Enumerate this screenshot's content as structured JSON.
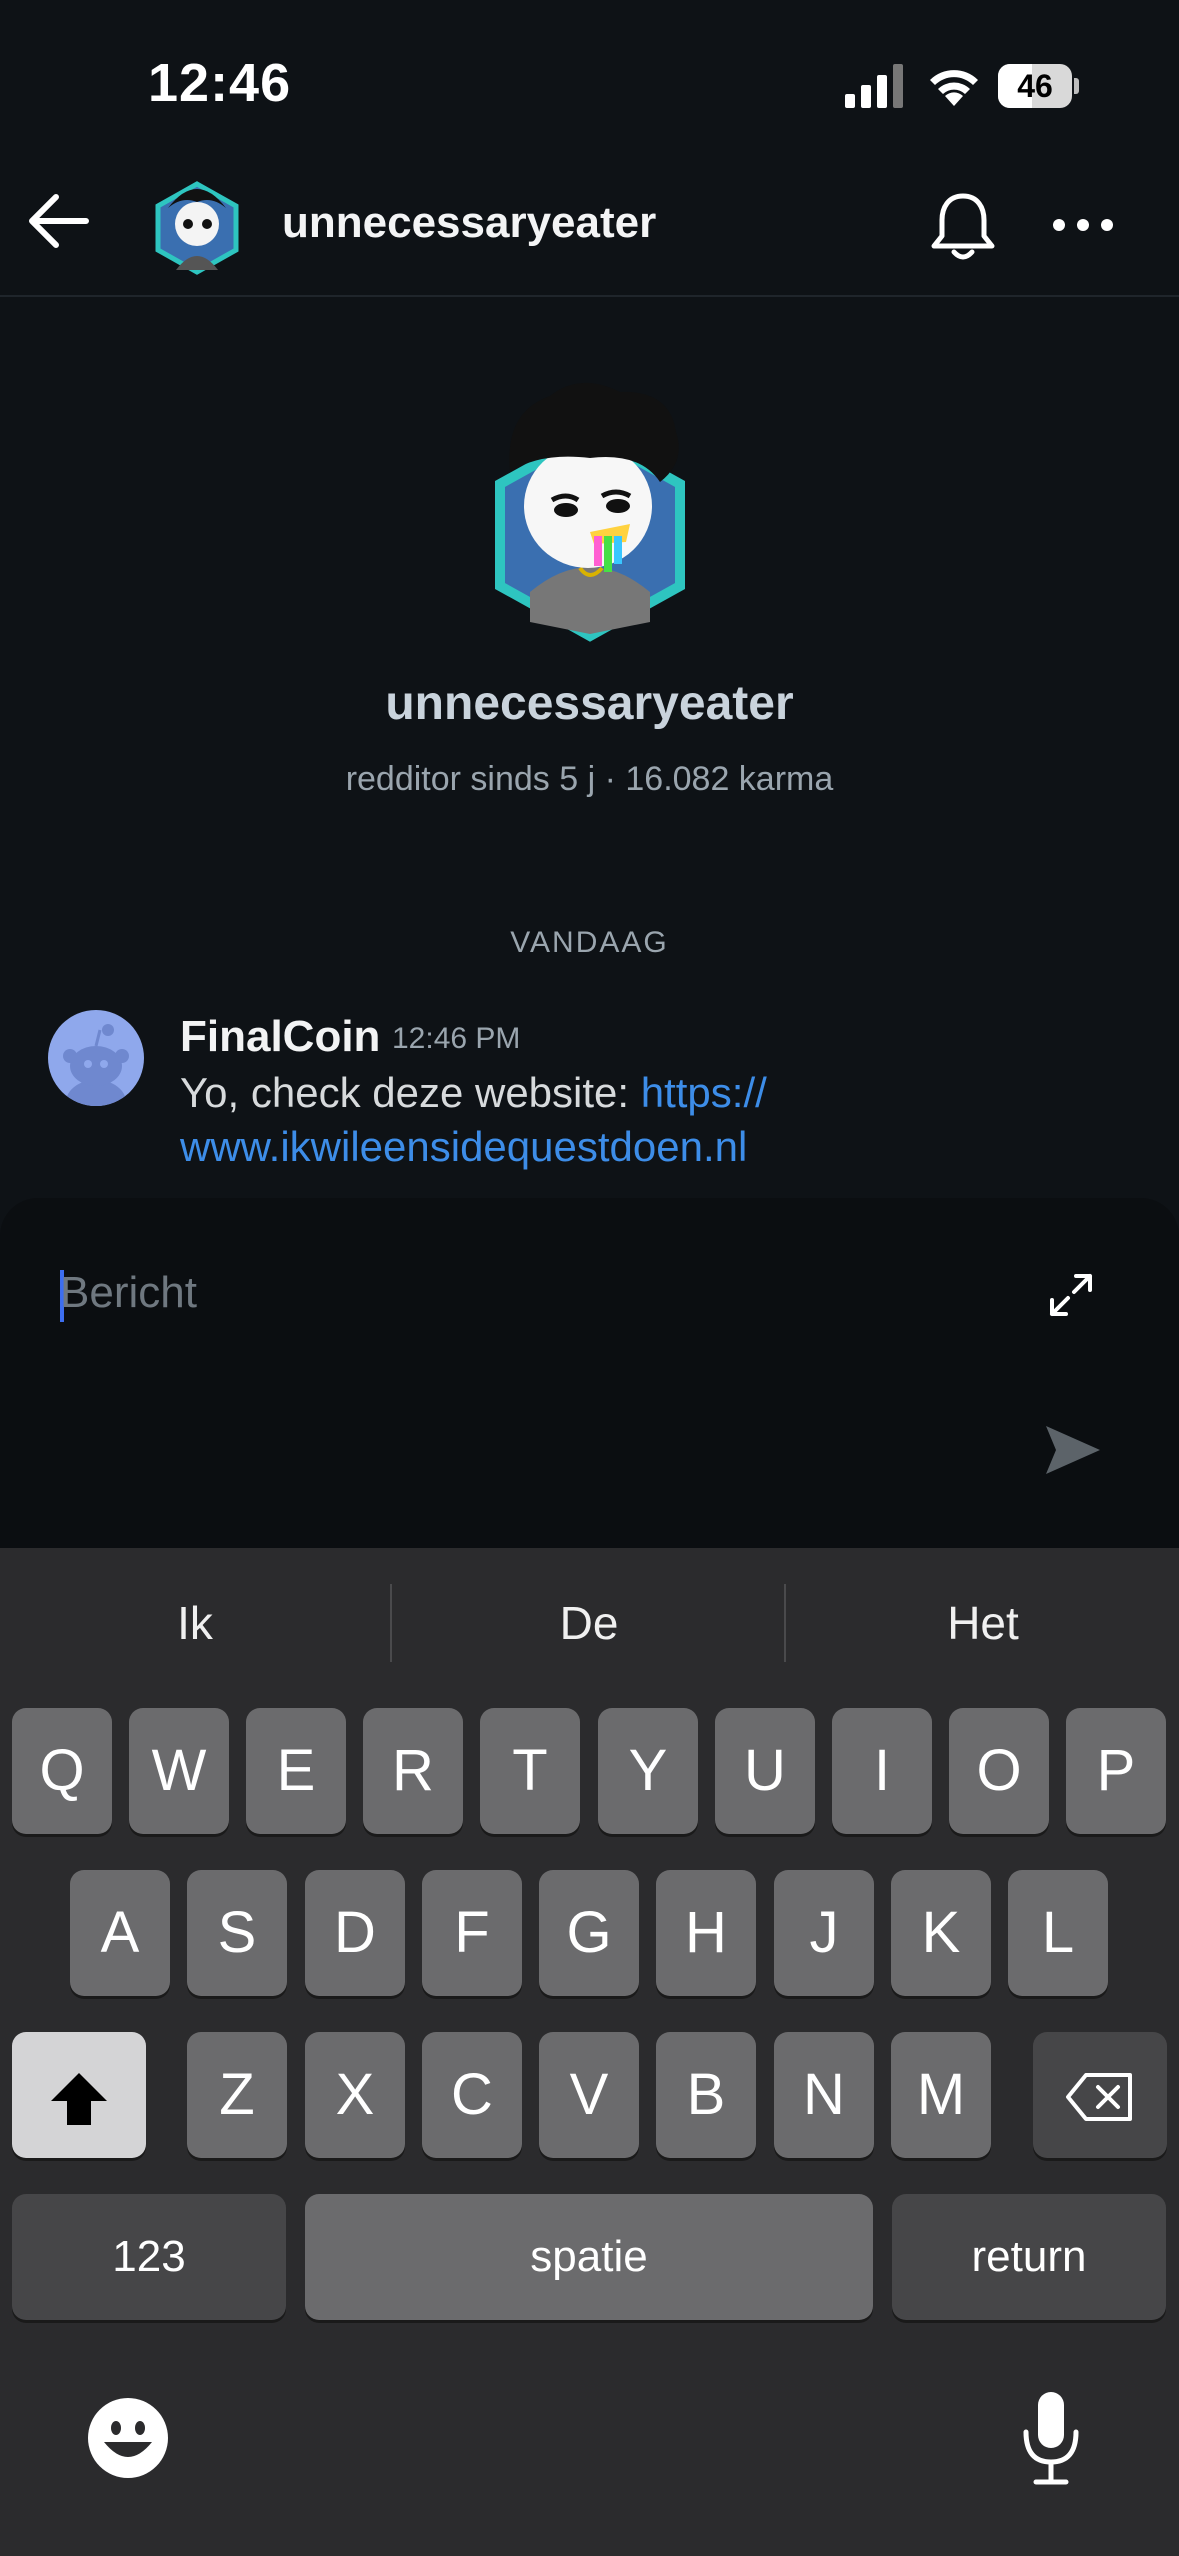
{
  "status_bar": {
    "time": "12:46",
    "battery": "46",
    "battery_level": 0.46
  },
  "header": {
    "title": "unnecessaryeater"
  },
  "profile": {
    "name": "unnecessaryeater",
    "meta": "redditor sinds 5 j · 16.082 karma"
  },
  "conversation": {
    "date_separator": "VANDAAG",
    "messages": [
      {
        "author": "FinalCoin",
        "time": "12:46 PM",
        "text": "Yo, check deze website: ",
        "link_part1": "https://",
        "link_part2": "www.ikwileensidequestdoen.nl"
      }
    ]
  },
  "composer": {
    "placeholder": "Bericht"
  },
  "keyboard": {
    "suggestions": [
      "Ik",
      "De",
      "Het"
    ],
    "row1": [
      "Q",
      "W",
      "E",
      "R",
      "T",
      "Y",
      "U",
      "I",
      "O",
      "P"
    ],
    "row2": [
      "A",
      "S",
      "D",
      "F",
      "G",
      "H",
      "J",
      "K",
      "L"
    ],
    "row3": [
      "Z",
      "X",
      "C",
      "V",
      "B",
      "N",
      "M"
    ],
    "numbers_label": "123",
    "space_label": "spatie",
    "return_label": "return"
  },
  "colors": {
    "background": "#0e1216",
    "link": "#3d8de8",
    "keyboard_bg": "#2b2b2d",
    "key_bg": "#6b6b6d",
    "avatar_bg": "#8fa8ec"
  },
  "icons": [
    "back-arrow-icon",
    "bell-icon",
    "more-icon",
    "expand-icon",
    "send-icon",
    "shift-icon",
    "backspace-icon",
    "emoji-icon",
    "microphone-icon",
    "signal-icon",
    "wifi-icon",
    "battery-icon"
  ]
}
